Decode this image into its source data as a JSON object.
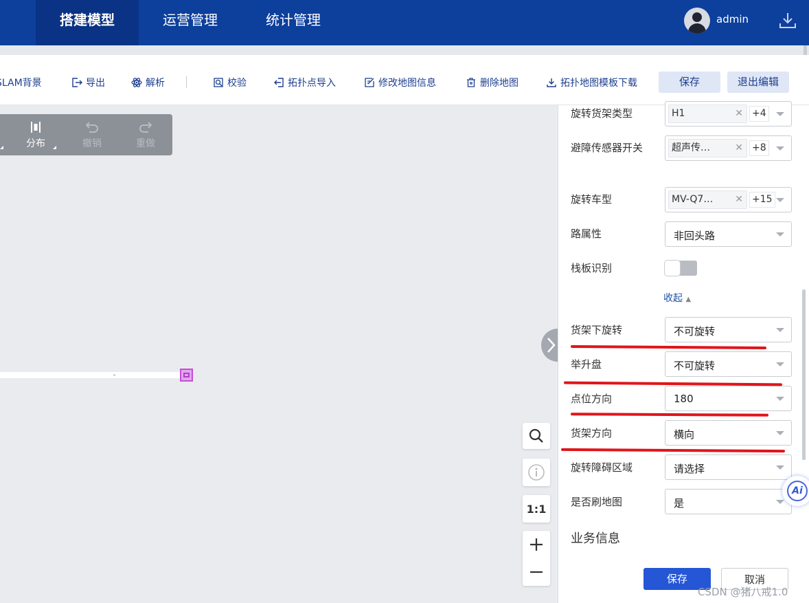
{
  "nav": {
    "tabs": [
      "搭建模型",
      "运营管理",
      "统计管理"
    ],
    "active_tab": "搭建模型",
    "username": "admin"
  },
  "toolbar": {
    "items": [
      "SLAM背景",
      "导出",
      "解析",
      "校验",
      "拓扑点导入",
      "修改地图信息",
      "删除地图",
      "拓扑地图模板下载"
    ],
    "save_label": "保存",
    "exit_label": "退出编辑"
  },
  "float_tools": {
    "distribute": "分布",
    "undo": "撤销",
    "redo": "重做"
  },
  "zoom_tools": {
    "one_to_one": "1:1"
  },
  "panel": {
    "fields": [
      {
        "label": "旋转货架类型",
        "tag": "H1",
        "more": "+4"
      },
      {
        "label": "避障传感器开关",
        "tag": "超声传…",
        "more": "+8"
      },
      {
        "label": "旋转车型",
        "tag": "MV-Q7…",
        "more": "+15"
      },
      {
        "label": "路属性",
        "value": "非回头路"
      }
    ],
    "pallet_label": "栈板识别",
    "collapse_label": "收起",
    "props": [
      {
        "label": "货架下旋转",
        "value": "不可旋转"
      },
      {
        "label": "举升盘",
        "value": "不可旋转"
      },
      {
        "label": "点位方向",
        "value": "180"
      },
      {
        "label": "货架方向",
        "value": "横向"
      },
      {
        "label": "旋转障碍区域",
        "value": "请选择"
      },
      {
        "label": "是否刷地图",
        "value": "是"
      }
    ],
    "section_title": "业务信息",
    "footer": {
      "save": "保存",
      "cancel": "取消"
    }
  },
  "ai_badge": "Ai",
  "watermark": "CSDN @猪八戒1.0",
  "colors": {
    "nav_bg": "#0d3f9c",
    "accent": "#1d3f8f",
    "primary_button": "#2456d6",
    "annotation_red": "#e0151b"
  }
}
